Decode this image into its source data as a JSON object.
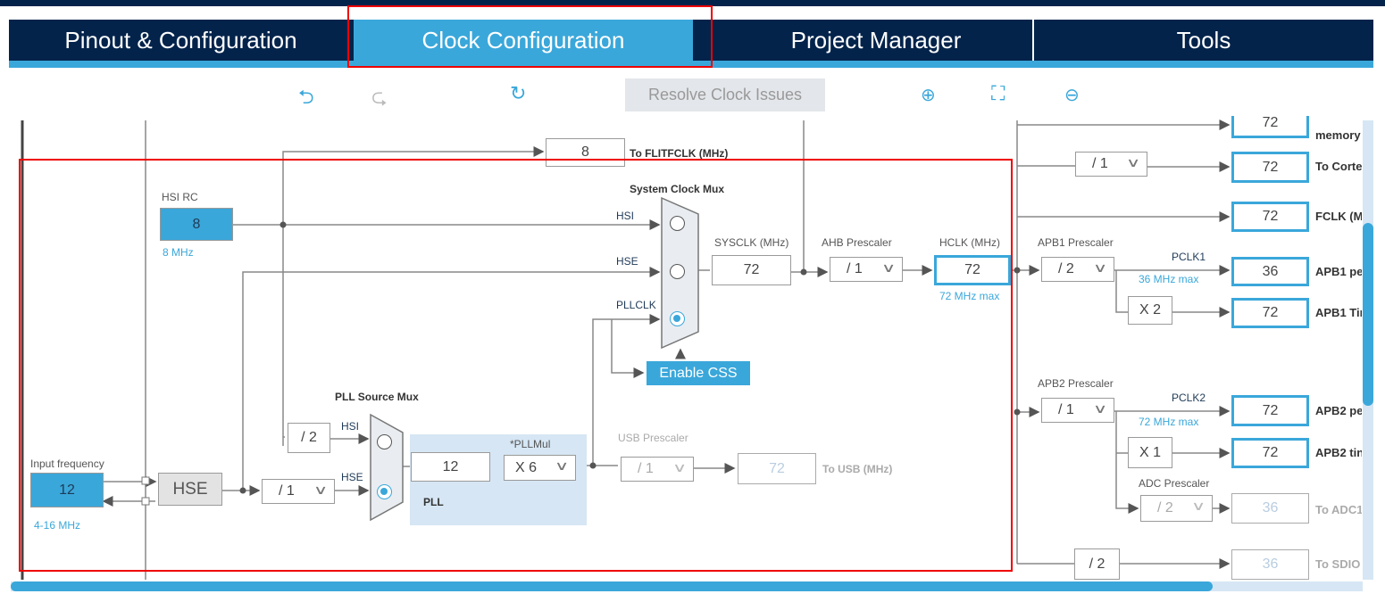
{
  "tabs": [
    {
      "label": "Pinout & Configuration"
    },
    {
      "label": "Clock Configuration",
      "active": true
    },
    {
      "label": "Project Manager"
    },
    {
      "label": "Tools"
    }
  ],
  "toolbar": {
    "undo": "undo-icon",
    "redo": "redo-icon",
    "reset": "refresh-icon",
    "resolve_label": "Resolve Clock Issues",
    "zoom_in": "zoom-in-icon",
    "fit": "fit-screen-icon",
    "zoom_out": "zoom-out-icon"
  },
  "colors": {
    "accent": "#3aa7da",
    "navy": "#03234b",
    "highlight": "#e00000",
    "pll_bg": "#d6e6f4"
  },
  "diagram": {
    "flitfclk": {
      "value": "8",
      "label": "To FLITFCLK (MHz)"
    },
    "hsi_rc": {
      "label": "HSI RC",
      "value": "8",
      "unit": "8 MHz"
    },
    "sys_mux": {
      "label": "System Clock Mux",
      "inputs": [
        "HSI",
        "HSE",
        "PLLCLK"
      ],
      "selected": "PLLCLK"
    },
    "sysclk": {
      "label": "SYSCLK (MHz)",
      "value": "72"
    },
    "ahb": {
      "label": "AHB Prescaler",
      "value": "/ 1"
    },
    "hclk": {
      "label": "HCLK (MHz)",
      "value": "72",
      "max": "72 MHz max"
    },
    "enable_css": "Enable CSS",
    "pll_mux": {
      "label": "PLL Source Mux",
      "hsi": "HSI",
      "hse": "HSE",
      "hsi_div": "/ 2",
      "selected": "HSE"
    },
    "pll": {
      "label": "PLL",
      "input": "12",
      "mul_label": "*PLLMul",
      "mul": "X 6"
    },
    "usb": {
      "label": "USB Prescaler",
      "div": "/ 1",
      "value": "72",
      "out_label": "To USB (MHz)"
    },
    "input": {
      "label": "Input frequency",
      "value": "12",
      "range": "4-16 MHz"
    },
    "hse": {
      "label": "HSE",
      "div": "/ 1"
    },
    "right": {
      "memory": {
        "value": "72",
        "label": "memory"
      },
      "cortex": {
        "div": "/ 1",
        "value": "72",
        "label": "To Corte"
      },
      "fclk": {
        "value": "72",
        "label": "FCLK (M"
      },
      "apb1": {
        "label": "APB1 Prescaler",
        "div": "/ 2",
        "pclk": "PCLK1",
        "max": "36 MHz max",
        "periph": "36",
        "periph_label": "APB1 pe",
        "timer_mul": "X 2",
        "timer": "72",
        "timer_label": "APB1 Tir"
      },
      "apb2": {
        "label": "APB2 Prescaler",
        "div": "/ 1",
        "pclk": "PCLK2",
        "max": "72 MHz max",
        "periph": "72",
        "periph_label": "APB2 pe",
        "timer_mul": "X 1",
        "timer": "72",
        "timer_label": "APB2 tin"
      },
      "adc": {
        "label": "ADC Prescaler",
        "div": "/ 2",
        "value": "36",
        "out_label": "To ADC1"
      },
      "sdio": {
        "div": "/ 2",
        "value": "36",
        "label": "To SDIO"
      }
    }
  }
}
